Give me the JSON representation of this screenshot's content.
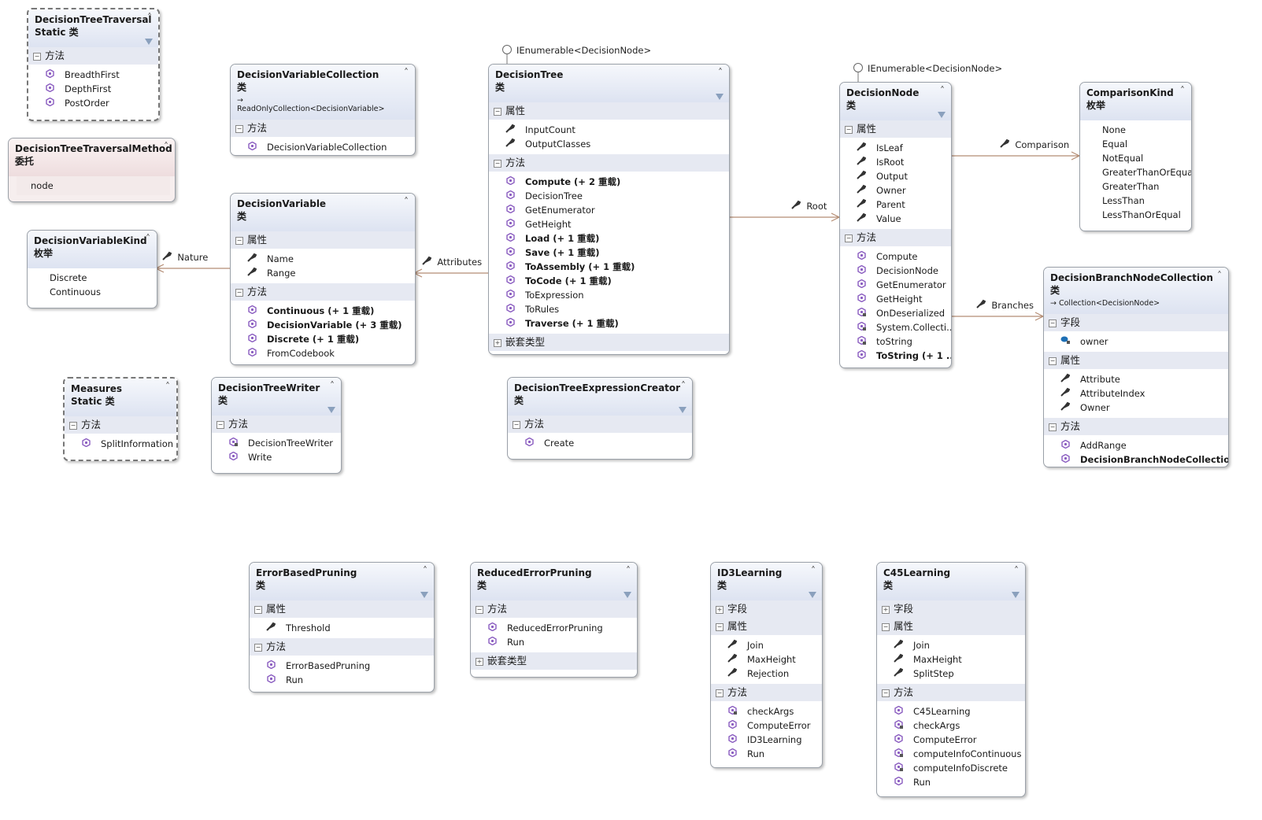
{
  "colors": {
    "method_icon": "#8a5cc0",
    "connector": "#b48c73",
    "section_bg": "#e6e9f2",
    "header_bg": "#dde3f1",
    "delegate_bg": "#eeddde"
  },
  "boxes": [
    {
      "name": "DecisionTreeTraversal",
      "kind": "Static 类",
      "style": "dashed",
      "filter": true,
      "sections": [
        {
          "label": "方法",
          "expanded": true,
          "items": [
            {
              "n": "BreadthFirst",
              "t": "m"
            },
            {
              "n": "DepthFirst",
              "t": "m"
            },
            {
              "n": "PostOrder",
              "t": "m"
            }
          ]
        }
      ]
    },
    {
      "name": "DecisionTreeTraversalMethod",
      "kind": "委托",
      "style": "delegate",
      "enum_values": [
        "node"
      ]
    },
    {
      "name": "DecisionVariableKind",
      "kind": "枚举",
      "style": "enum",
      "enum_values": [
        "Discrete",
        "Continuous"
      ]
    },
    {
      "name": "Measures",
      "kind": "Static 类",
      "style": "dashed",
      "sections": [
        {
          "label": "方法",
          "expanded": true,
          "items": [
            {
              "n": "SplitInformation",
              "t": "m"
            }
          ]
        }
      ]
    },
    {
      "name": "DecisionVariableCollection",
      "kind": "类",
      "base": "ReadOnlyCollection<DecisionVariable>",
      "sections": [
        {
          "label": "方法",
          "expanded": true,
          "items": [
            {
              "n": "DecisionVariableCollection",
              "t": "m"
            }
          ]
        }
      ]
    },
    {
      "name": "DecisionVariable",
      "kind": "类",
      "sections": [
        {
          "label": "属性",
          "expanded": true,
          "items": [
            {
              "n": "Name",
              "t": "p"
            },
            {
              "n": "Range",
              "t": "p"
            }
          ]
        },
        {
          "label": "方法",
          "expanded": true,
          "items": [
            {
              "n": "Continuous (+ 1 重载)",
              "t": "m",
              "b": true
            },
            {
              "n": "DecisionVariable (+ 3 重载)",
              "t": "m",
              "b": true
            },
            {
              "n": "Discrete (+ 1 重载)",
              "t": "m",
              "b": true
            },
            {
              "n": "FromCodebook",
              "t": "m"
            }
          ]
        }
      ]
    },
    {
      "name": "DecisionTreeWriter",
      "kind": "类",
      "filter": true,
      "sections": [
        {
          "label": "方法",
          "expanded": true,
          "items": [
            {
              "n": "DecisionTreeWriter",
              "t": "mp"
            },
            {
              "n": "Write",
              "t": "m"
            }
          ]
        }
      ]
    },
    {
      "name": "DecisionTree",
      "kind": "类",
      "filter": true,
      "interface": "IEnumerable<DecisionNode>",
      "sections": [
        {
          "label": "属性",
          "expanded": true,
          "items": [
            {
              "n": "InputCount",
              "t": "p"
            },
            {
              "n": "OutputClasses",
              "t": "p"
            }
          ]
        },
        {
          "label": "方法",
          "expanded": true,
          "items": [
            {
              "n": "Compute (+ 2 重载)",
              "t": "m",
              "b": true
            },
            {
              "n": "DecisionTree",
              "t": "m"
            },
            {
              "n": "GetEnumerator",
              "t": "m"
            },
            {
              "n": "GetHeight",
              "t": "m"
            },
            {
              "n": "Load (+ 1 重载)",
              "t": "m",
              "b": true
            },
            {
              "n": "Save (+ 1 重载)",
              "t": "m",
              "b": true
            },
            {
              "n": "ToAssembly (+ 1 重载)",
              "t": "m",
              "b": true
            },
            {
              "n": "ToCode (+ 1 重载)",
              "t": "m",
              "b": true
            },
            {
              "n": "ToExpression",
              "t": "m"
            },
            {
              "n": "ToRules",
              "t": "m"
            },
            {
              "n": "Traverse (+ 1 重载)",
              "t": "m",
              "b": true
            }
          ]
        },
        {
          "label": "嵌套类型",
          "expanded": false,
          "items": []
        }
      ]
    },
    {
      "name": "DecisionTreeExpressionCreator",
      "kind": "类",
      "filter": true,
      "sections": [
        {
          "label": "方法",
          "expanded": true,
          "items": [
            {
              "n": "Create",
              "t": "m"
            }
          ]
        }
      ]
    },
    {
      "name": "DecisionNode",
      "kind": "类",
      "filter": true,
      "interface": "IEnumerable<DecisionNode>",
      "sections": [
        {
          "label": "属性",
          "expanded": true,
          "items": [
            {
              "n": "IsLeaf",
              "t": "p"
            },
            {
              "n": "IsRoot",
              "t": "p"
            },
            {
              "n": "Output",
              "t": "p"
            },
            {
              "n": "Owner",
              "t": "p"
            },
            {
              "n": "Parent",
              "t": "p"
            },
            {
              "n": "Value",
              "t": "p"
            }
          ]
        },
        {
          "label": "方法",
          "expanded": true,
          "items": [
            {
              "n": "Compute",
              "t": "m"
            },
            {
              "n": "DecisionNode",
              "t": "m"
            },
            {
              "n": "GetEnumerator",
              "t": "m"
            },
            {
              "n": "GetHeight",
              "t": "m"
            },
            {
              "n": "OnDeserialized",
              "t": "mp"
            },
            {
              "n": "System.Collecti...",
              "t": "mp"
            },
            {
              "n": "toString",
              "t": "mp"
            },
            {
              "n": "ToString (+ 1 ...",
              "t": "m",
              "b": true
            }
          ]
        }
      ]
    },
    {
      "name": "ComparisonKind",
      "kind": "枚举",
      "style": "enum",
      "enum_values": [
        "None",
        "Equal",
        "NotEqual",
        "GreaterThanOrEqual",
        "GreaterThan",
        "LessThan",
        "LessThanOrEqual"
      ]
    },
    {
      "name": "DecisionBranchNodeCollection",
      "kind": "类",
      "base": "Collection<DecisionNode>",
      "sections": [
        {
          "label": "字段",
          "expanded": true,
          "items": [
            {
              "n": "owner",
              "t": "f"
            }
          ]
        },
        {
          "label": "属性",
          "expanded": true,
          "items": [
            {
              "n": "Attribute",
              "t": "p"
            },
            {
              "n": "AttributeIndex",
              "t": "p"
            },
            {
              "n": "Owner",
              "t": "p"
            }
          ]
        },
        {
          "label": "方法",
          "expanded": true,
          "items": [
            {
              "n": "AddRange",
              "t": "m"
            },
            {
              "n": "DecisionBranchNodeCollection [...",
              "t": "m",
              "b": true
            }
          ]
        }
      ]
    },
    {
      "name": "ErrorBasedPruning",
      "kind": "类",
      "filter": true,
      "sections": [
        {
          "label": "属性",
          "expanded": true,
          "items": [
            {
              "n": "Threshold",
              "t": "p"
            }
          ]
        },
        {
          "label": "方法",
          "expanded": true,
          "items": [
            {
              "n": "ErrorBasedPruning",
              "t": "m"
            },
            {
              "n": "Run",
              "t": "m"
            }
          ]
        }
      ]
    },
    {
      "name": "ReducedErrorPruning",
      "kind": "类",
      "filter": true,
      "sections": [
        {
          "label": "方法",
          "expanded": true,
          "items": [
            {
              "n": "ReducedErrorPruning",
              "t": "m"
            },
            {
              "n": "Run",
              "t": "m"
            }
          ]
        },
        {
          "label": "嵌套类型",
          "expanded": false,
          "items": []
        }
      ]
    },
    {
      "name": "ID3Learning",
      "kind": "类",
      "filter": true,
      "sections": [
        {
          "label": "字段",
          "expanded": false,
          "items": []
        },
        {
          "label": "属性",
          "expanded": true,
          "items": [
            {
              "n": "Join",
              "t": "p"
            },
            {
              "n": "MaxHeight",
              "t": "p"
            },
            {
              "n": "Rejection",
              "t": "p"
            }
          ]
        },
        {
          "label": "方法",
          "expanded": true,
          "items": [
            {
              "n": "checkArgs",
              "t": "mp"
            },
            {
              "n": "ComputeError",
              "t": "m"
            },
            {
              "n": "ID3Learning",
              "t": "m"
            },
            {
              "n": "Run",
              "t": "m"
            }
          ]
        }
      ]
    },
    {
      "name": "C45Learning",
      "kind": "类",
      "filter": true,
      "sections": [
        {
          "label": "字段",
          "expanded": false,
          "items": []
        },
        {
          "label": "属性",
          "expanded": true,
          "items": [
            {
              "n": "Join",
              "t": "p"
            },
            {
              "n": "MaxHeight",
              "t": "p"
            },
            {
              "n": "SplitStep",
              "t": "p"
            }
          ]
        },
        {
          "label": "方法",
          "expanded": true,
          "items": [
            {
              "n": "C45Learning",
              "t": "m"
            },
            {
              "n": "checkArgs",
              "t": "mp"
            },
            {
              "n": "ComputeError",
              "t": "m"
            },
            {
              "n": "computeInfoContinuous",
              "t": "mp"
            },
            {
              "n": "computeInfoDiscrete",
              "t": "mp"
            },
            {
              "n": "Run",
              "t": "m"
            }
          ]
        }
      ]
    }
  ],
  "associations": [
    {
      "label": "Nature",
      "from": "DecisionVariable",
      "to": "DecisionVariableKind"
    },
    {
      "label": "Attributes",
      "from": "DecisionTree",
      "to": "DecisionVariable"
    },
    {
      "label": "Root",
      "from": "DecisionTree",
      "to": "DecisionNode"
    },
    {
      "label": "Comparison",
      "from": "DecisionNode",
      "to": "ComparisonKind"
    },
    {
      "label": "Branches",
      "from": "DecisionNode",
      "to": "DecisionBranchNodeCollection"
    }
  ]
}
